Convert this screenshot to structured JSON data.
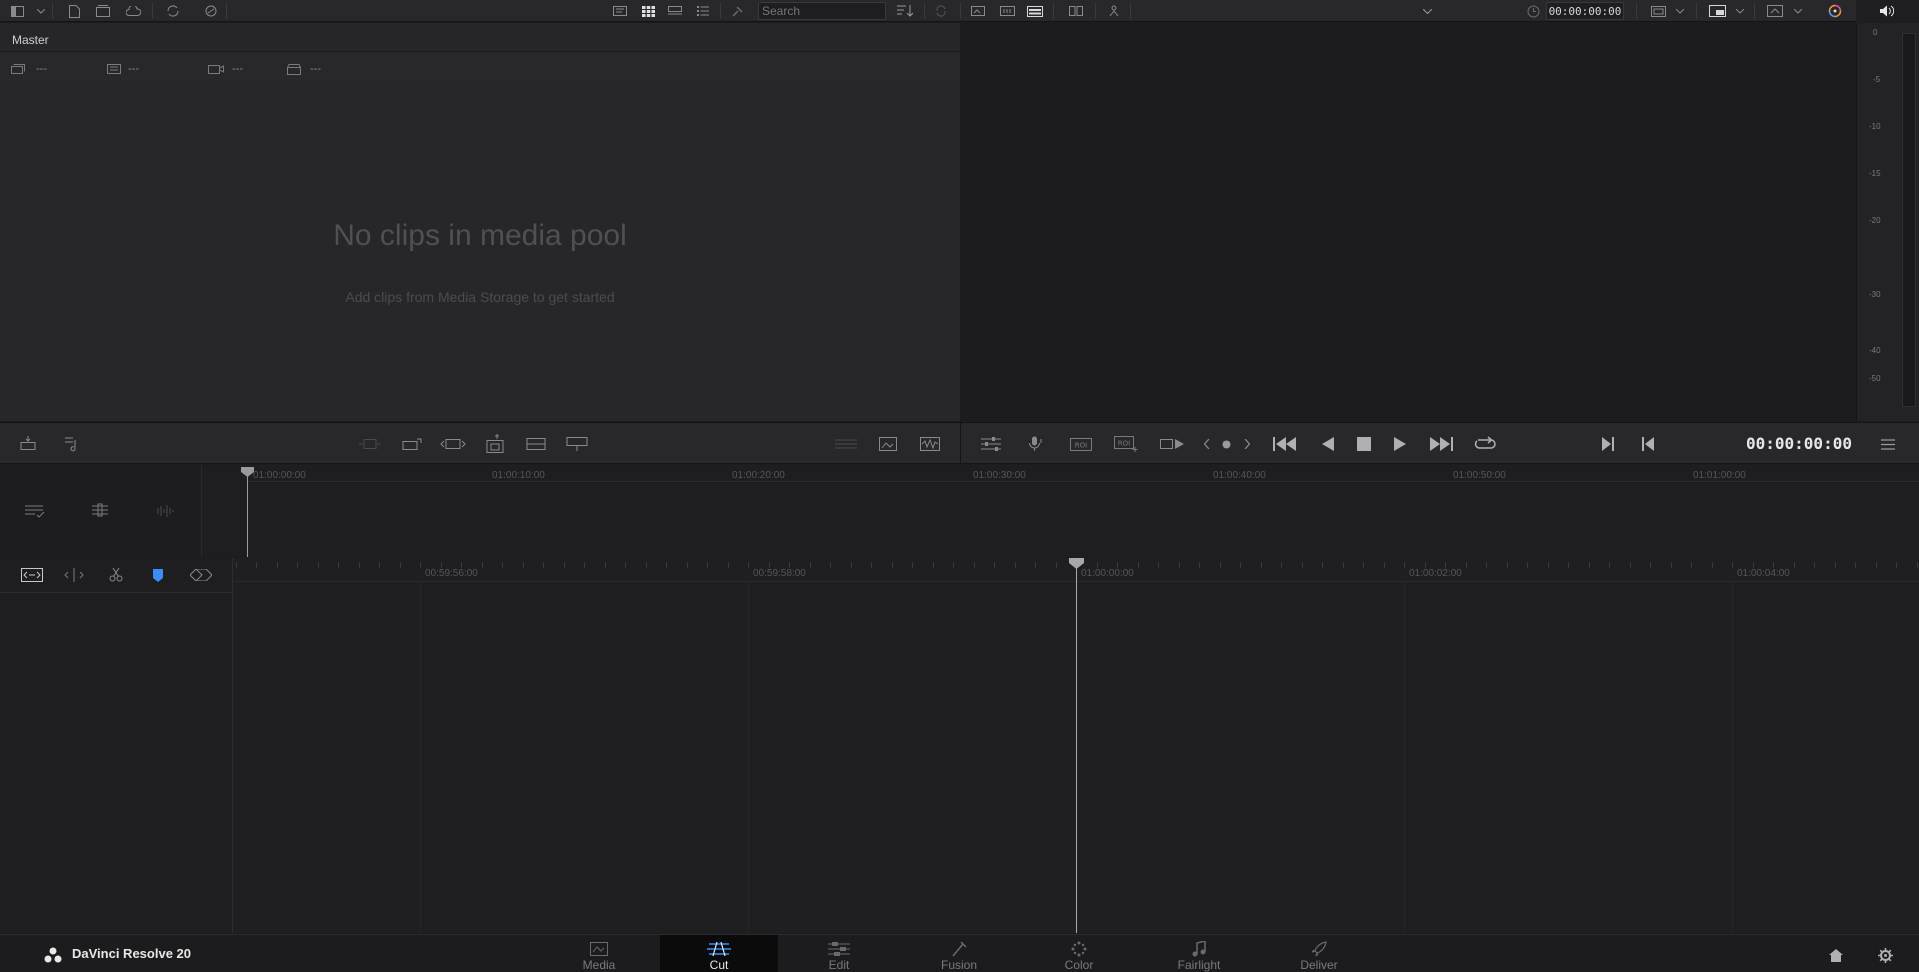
{
  "toolbar": {
    "search_placeholder": "Search",
    "viewer_timecode": "00:00:00:00",
    "menu_icons": [
      "sidebar-icon",
      "new-bin-icon",
      "new-smart-bin-icon",
      "cloud-icon",
      "relink-icon",
      "link-icon",
      "metadata-view-icon",
      "thumbnail-view-icon",
      "filmstrip-view-icon",
      "list-view-icon",
      "sort-icon",
      "sync-icon"
    ]
  },
  "media_pool": {
    "bin_name": "Master",
    "metadata_fields": [
      "---",
      "---",
      "---",
      "---"
    ],
    "empty_title": "No clips in media pool",
    "empty_subtitle": "Add clips from Media Storage to get started"
  },
  "audio_meter": {
    "scale": [
      "0",
      "-5",
      "-10",
      "-15",
      "-20",
      "-30",
      "-40",
      "-50"
    ]
  },
  "transport": {
    "timecode": "00:00:00:00"
  },
  "upper_timeline": {
    "ruler_labels": [
      "01:00:00:00",
      "01:00:10:00",
      "01:00:20:00",
      "01:00:30:00",
      "01:00:40:00",
      "01:00:50:00",
      "01:01:00:00"
    ]
  },
  "lower_timeline": {
    "ruler_labels": [
      "00:59:56:00",
      "00:59:58:00",
      "01:00:00:00",
      "01:00:02:00",
      "01:00:04:00"
    ]
  },
  "footer": {
    "app_name": "DaVinci Resolve 20",
    "pages": [
      {
        "label": "Media",
        "icon": "media-page-icon"
      },
      {
        "label": "Cut",
        "icon": "cut-page-icon"
      },
      {
        "label": "Edit",
        "icon": "edit-page-icon"
      },
      {
        "label": "Fusion",
        "icon": "fusion-page-icon"
      },
      {
        "label": "Color",
        "icon": "color-page-icon"
      },
      {
        "label": "Fairlight",
        "icon": "fairlight-page-icon"
      },
      {
        "label": "Deliver",
        "icon": "deliver-page-icon"
      }
    ],
    "active_page": "Cut"
  },
  "colors": {
    "accent_blue": "#3d8bff",
    "panel": "#27272b",
    "toolbar": "#28282c"
  }
}
